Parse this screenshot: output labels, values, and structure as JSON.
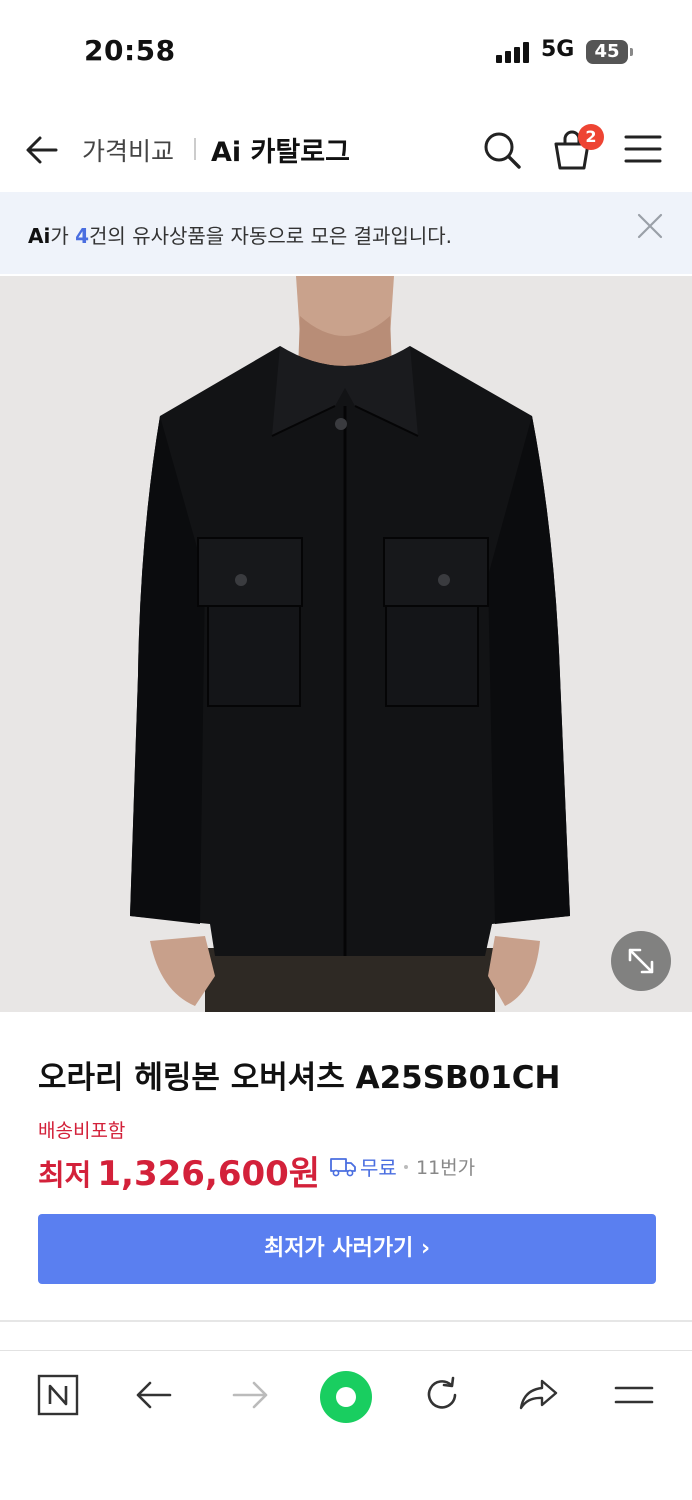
{
  "status": {
    "time": "20:58",
    "network": "5G",
    "battery": "45"
  },
  "header": {
    "crumb_primary": "가격비교",
    "crumb_secondary": "Ai 카탈로그",
    "cart_count": "2"
  },
  "banner": {
    "ai_logo": "Ai",
    "prefix": "가 ",
    "count": "4",
    "suffix": "건의 유사상품을 자동으로 모은 결과입니다."
  },
  "product": {
    "name": "오라리 헤링본 오버셔츠 A25SB01CH",
    "shipping_included": "배송비포함",
    "price_label": "최저",
    "price": "1,326,600원",
    "shipping": "무료",
    "seller": "11번가",
    "cta": "최저가 사러가기 ›"
  },
  "icons": {
    "back": "arrow-left-icon",
    "search": "search-icon",
    "cart": "shopping-bag-icon",
    "menu": "hamburger-menu-icon",
    "close": "close-icon",
    "expand": "expand-icon",
    "truck": "truck-icon"
  },
  "colors": {
    "price_red": "#d3213a",
    "accent_blue": "#5a7ff0",
    "naver_green": "#19ce60",
    "badge_red": "#ee4433"
  }
}
